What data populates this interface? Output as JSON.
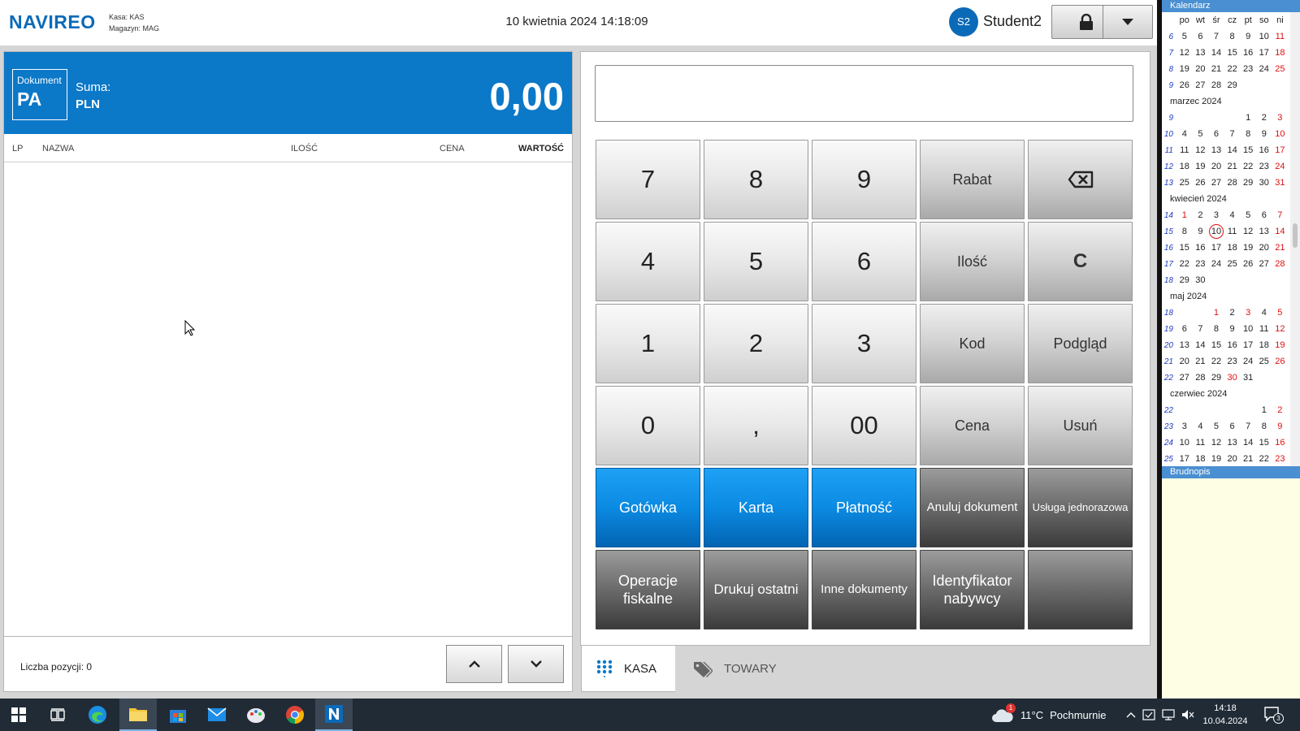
{
  "app": {
    "logo": "NAVIREO",
    "kasa": "Kasa: KAS",
    "magazyn": "Magazyn: MAG",
    "datetime": "10 kwietnia 2024 14:18:09"
  },
  "user": {
    "initials": "S2",
    "name": "Student2"
  },
  "document": {
    "label": "Dokument",
    "type": "PA",
    "sum_label": "Suma:",
    "currency": "PLN",
    "sum_value": "0,00"
  },
  "columns": {
    "lp": "LP",
    "name": "NAZWA",
    "qty": "ILOŚĆ",
    "price": "CENA",
    "value": "WARTOŚĆ"
  },
  "footer": {
    "count_label": "Liczba pozycji: 0"
  },
  "input": {
    "value": ""
  },
  "keypad": {
    "k7": "7",
    "k8": "8",
    "k9": "9",
    "rabat": "Rabat",
    "k4": "4",
    "k5": "5",
    "k6": "6",
    "ilosc": "Ilość",
    "clear": "C",
    "k1": "1",
    "k2": "2",
    "k3": "3",
    "kod": "Kod",
    "podglad": "Podgląd",
    "k0": "0",
    "comma": ",",
    "k00": "00",
    "cena": "Cena",
    "usun": "Usuń",
    "gotowka": "Gotówka",
    "karta": "Karta",
    "platnosc": "Płatność",
    "anuluj": "Anuluj dokument",
    "usluga": "Usługa jednorazowa",
    "operacje": "Operacje fiskalne",
    "drukuj": "Drukuj ostatni",
    "inne": "Inne dokumenty",
    "identyfikator": "Identyfikator nabywcy"
  },
  "tabs": {
    "kasa": "KASA",
    "towary": "TOWARY"
  },
  "calendar": {
    "title": "Kalendarz",
    "weekdays": [
      "po",
      "wt",
      "śr",
      "cz",
      "pt",
      "so",
      "ni"
    ],
    "blocks": [
      {
        "month": "",
        "weeks": [
          [
            "6",
            "5",
            "6",
            "7",
            "8",
            "9",
            "10",
            "11"
          ],
          [
            "7",
            "12",
            "13",
            "14",
            "15",
            "16",
            "17",
            "18"
          ],
          [
            "8",
            "19",
            "20",
            "21",
            "22",
            "23",
            "24",
            "25"
          ],
          [
            "9",
            "26",
            "27",
            "28",
            "29",
            "",
            "",
            ""
          ]
        ]
      },
      {
        "month": "marzec 2024",
        "weeks": [
          [
            "9",
            "",
            "",
            "",
            "",
            "1",
            "2",
            "3"
          ],
          [
            "10",
            "4",
            "5",
            "6",
            "7",
            "8",
            "9",
            "10"
          ],
          [
            "11",
            "11",
            "12",
            "13",
            "14",
            "15",
            "16",
            "17"
          ],
          [
            "12",
            "18",
            "19",
            "20",
            "21",
            "22",
            "23",
            "24"
          ],
          [
            "13",
            "25",
            "26",
            "27",
            "28",
            "29",
            "30",
            "31"
          ]
        ]
      },
      {
        "month": "kwiecień 2024",
        "weeks": [
          [
            "14",
            "1",
            "2",
            "3",
            "4",
            "5",
            "6",
            "7"
          ],
          [
            "15",
            "8",
            "9",
            "10",
            "11",
            "12",
            "13",
            "14"
          ],
          [
            "16",
            "15",
            "16",
            "17",
            "18",
            "19",
            "20",
            "21"
          ],
          [
            "17",
            "22",
            "23",
            "24",
            "25",
            "26",
            "27",
            "28"
          ],
          [
            "18",
            "29",
            "30",
            "",
            "",
            "",
            "",
            ""
          ]
        ]
      },
      {
        "month": "maj 2024",
        "weeks": [
          [
            "18",
            "",
            "",
            "1",
            "2",
            "3",
            "4",
            "5"
          ],
          [
            "19",
            "6",
            "7",
            "8",
            "9",
            "10",
            "11",
            "12"
          ],
          [
            "20",
            "13",
            "14",
            "15",
            "16",
            "17",
            "18",
            "19"
          ],
          [
            "21",
            "20",
            "21",
            "22",
            "23",
            "24",
            "25",
            "26"
          ],
          [
            "22",
            "27",
            "28",
            "29",
            "30",
            "31",
            "",
            ""
          ]
        ]
      },
      {
        "month": "czerwiec 2024",
        "weeks": [
          [
            "22",
            "",
            "",
            "",
            "",
            "",
            "1",
            "2"
          ],
          [
            "23",
            "3",
            "4",
            "5",
            "6",
            "7",
            "8",
            "9"
          ],
          [
            "24",
            "10",
            "11",
            "12",
            "13",
            "14",
            "15",
            "16"
          ],
          [
            "25",
            "17",
            "18",
            "19",
            "20",
            "21",
            "22",
            "23"
          ]
        ]
      }
    ],
    "holidays": [
      "1-1",
      "3-2",
      "4-5",
      "4-0"
    ],
    "today": "10"
  },
  "notes": {
    "title": "Brudnopis"
  },
  "taskbar": {
    "temperature": "11°C",
    "weather": "Pochmurnie",
    "time": "14:18",
    "date": "10.04.2024",
    "notifications": "3",
    "weather_badge": "1"
  },
  "colors": {
    "brand": "#0b6ab8",
    "doc_header": "#0b78c8",
    "key_blue": "#0b8ae2",
    "key_dark": "#555555",
    "sunday": "#dd1111"
  }
}
